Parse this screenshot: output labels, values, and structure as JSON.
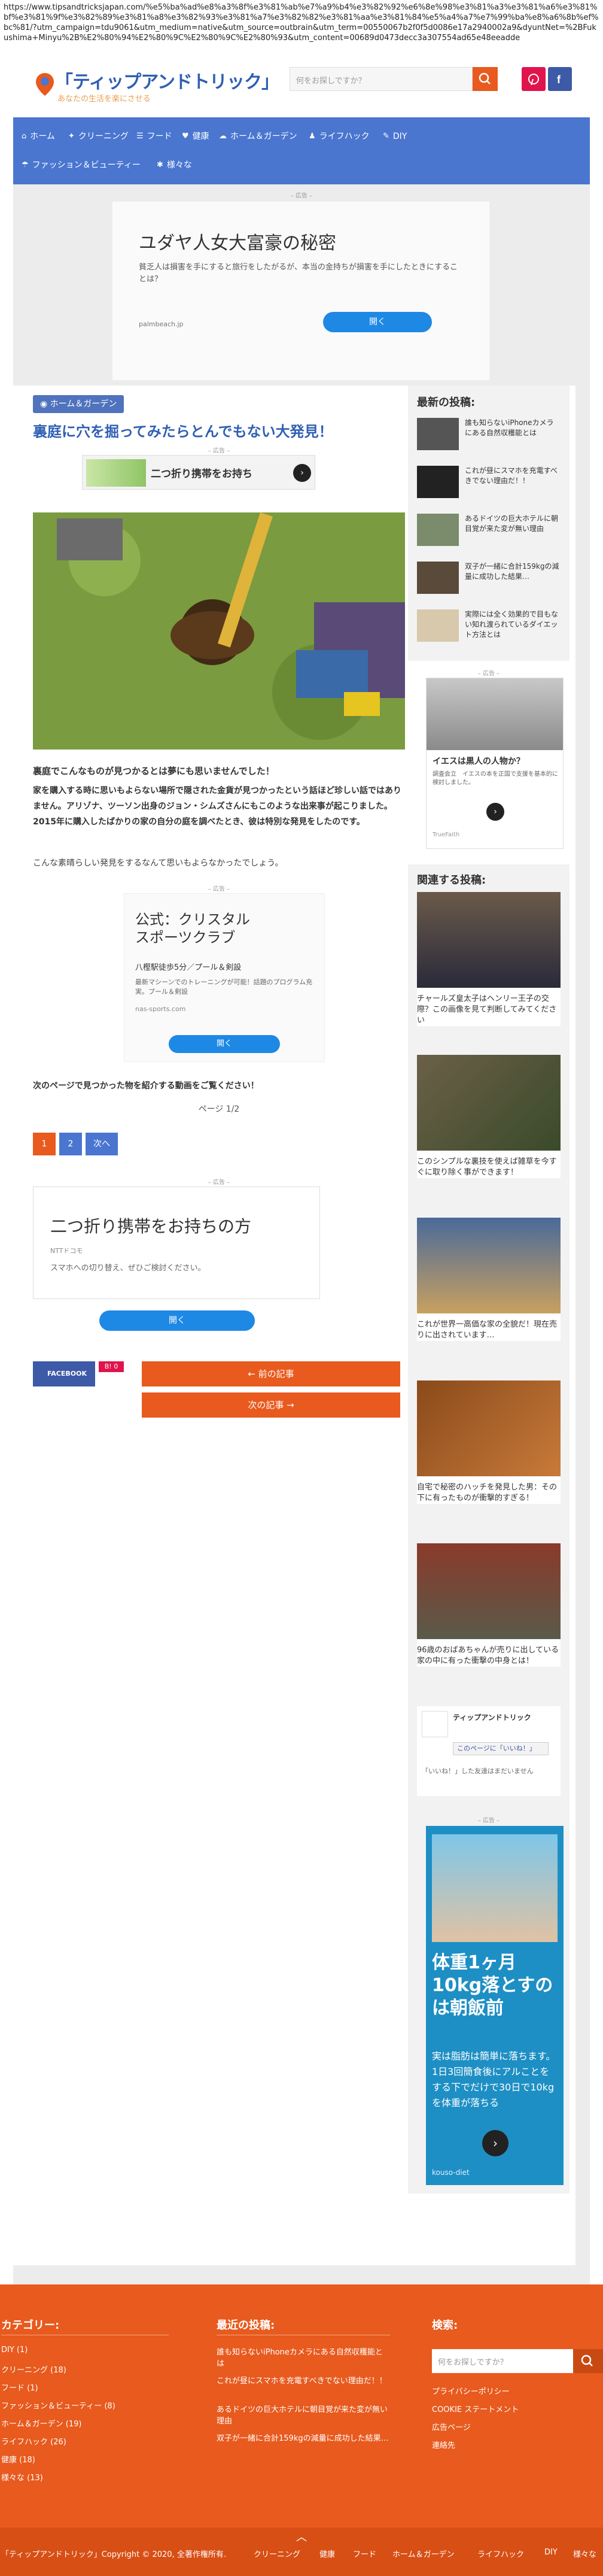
{
  "browser": {
    "url": "https://www.tipsandtricksjapan.com/%e5%ba%ad%e8%a3%8f%e3%81%ab%e7%a9%b4%e3%82%92%e6%8e%98%e3%81%a3%e3%81%a6%e3%81%bf%e3%81%9f%e3%82%89%e3%81%a8%e3%82%93%e3%81%a7%e3%82%82%e3%81%aa%e3%81%84%e5%a4%a7%e7%99%ba%e8%a6%8b%ef%bc%81/?utm_campaign=tdu9061&utm_medium=native&utm_source=outbrain&utm_term=00550067b2f0f5d0086e17a2940002a9&dyuntNet=%2BFukushima+Minyu%2B%E2%80%94%E2%80%9C%E2%80%9C%E2%80%93&utm_content=00689d0473decc3a307554ad65e48eeadde"
  },
  "header": {
    "logo_title": "「ティップアンドトリック」",
    "logo_subtitle": "あなたの生活を楽にさせる",
    "search_placeholder": "何をお探しですか？",
    "search_icon": "search-icon",
    "social": [
      "pinterest-icon",
      "facebook-icon"
    ]
  },
  "nav": {
    "items": [
      {
        "icon": "home-icon",
        "label": "ホーム"
      },
      {
        "icon": "cleaning-icon",
        "label": "クリーニング"
      },
      {
        "icon": "food-icon",
        "label": "フード"
      },
      {
        "icon": "health-icon",
        "label": "健康"
      },
      {
        "icon": "home-garden-icon",
        "label": "ホーム＆ガーデン"
      },
      {
        "icon": "lifehack-icon",
        "label": "ライフハック"
      },
      {
        "icon": "diy-icon",
        "label": "DIY"
      },
      {
        "icon": "fashion-icon",
        "label": "ファッション＆ビューティー"
      },
      {
        "icon": "misc-icon",
        "label": "様々な"
      }
    ]
  },
  "ads": {
    "label": "– 広告 –",
    "top": {
      "headline": "ユダヤ人女大富豪の秘密",
      "body": "貧乏人は損害を手にすると旅行をしたがるが、本当の金持ちが損害を手にしたときにすることは？",
      "domain": "palmbeach.jp",
      "button": "開く"
    },
    "inline1": {
      "text": "二つ折り携帯をお持ち"
    },
    "inline2": {
      "headline": "公式：クリスタル スポーツクラブ",
      "sub": "八樫駅徒歩5分／プール＆剣設",
      "body": "最新マシーンでのトレーニングが可能！話題のプログラム充実。プール＆剣設",
      "domain": "nas-sports.com",
      "button": "開く"
    },
    "inline3": {
      "headline": "二つ折り携帯をお持ちの方",
      "brand": "NTTドコモ",
      "body": "スマホへの切り替え、ぜひご検討ください。",
      "button": "開く"
    },
    "sidebar1": {
      "headline": "イエスは黒人の人物か？",
      "body": "調査会立　イエスの本を正国で支援を基本的に検討しました。",
      "brand": "TrueFaith"
    },
    "sidebar2": {
      "headline": "体重1ヶ月10kg落とすのは朝飯前",
      "body": "実は脂肪は簡単に落ちます。1日3回簡食後にアルことをする下でだけで30日で10kgを体重が落ちる",
      "domain": "kouso-diet"
    }
  },
  "article": {
    "category_icon": "tag-icon",
    "category": "ホーム＆ガーデン",
    "title": "裏庭に穴を掘ってみたらとんでもない大発見！",
    "hero_image": "digging-in-backyard-photo",
    "lead": "裏庭でこんなものが見つかるとは夢にも思いませんでした！",
    "para1": "家を購入する時に思いもよらない場所で隠された金貨が見つかったという話ほど珍しい話ではありません。アリゾナ、ツーソン出身のジョン・シムズさんにもこのような出来事が起こりました。2015年に購入したばかりの家の自分の庭を調べたとき、彼は特別な発見をしたのです。",
    "para2": "こんな素晴らしい発見をするなんて思いもよらなかったでしょう。",
    "next_page": "次のページで見つかった物を紹介する動画をご覧ください！",
    "page_counter": "ページ 1/2",
    "pages": [
      "1",
      "2",
      "次へ"
    ],
    "share": {
      "facebook": "FACEBOOK",
      "hatena": "B! 0"
    },
    "prev_post": "← 前の記事",
    "next_post": "次の記事 →"
  },
  "sidebar": {
    "recent_title": "最新の投稿:",
    "recent": [
      "誰も知らないiPhoneカメラにある自然収穫能とは",
      "これが昼にスマホを充電すべきでない理由だ！！",
      "あるドイツの巨大ホテルに朝目覚が来た変が無い理由",
      "双子が一緒に合計159kgの減量に成功した結果…",
      "実際には全く効果的で目もない知れ渡られているダイエット方法とは"
    ],
    "related_title": "関連する投稿:",
    "related": [
      "チャールズ皇太子はヘンリー王子の交際？この画像を見て判断してみてください",
      "このシンプルな裏技を使えば雑草を今すぐに取り除く事ができます！",
      "これが世界一高価な家の全貌だ！現在売りに出されています…",
      "自宅で秘密のハッチを発見した男：その下に有ったものが衝撃的すぎる！",
      "96歳のおばあちゃんが売りに出している家の中に有った衝撃の中身とは！",
      "ティップアンドトリック\nこのページに「いいね！」"
    ],
    "fb_widget": {
      "title": "ティップアンドトリック",
      "like": "このページに「いいね！」",
      "note": "「いいね！」した友達はまだいません"
    }
  },
  "footer": {
    "categories_title": "カテゴリー:",
    "categories": [
      "DIY (1)",
      "クリーニング (18)",
      "フード (1)",
      "ファッション＆ビューティー (8)",
      "ホーム＆ガーデン (19)",
      "ライフハック (26)",
      "健康 (18)",
      "様々な (13)"
    ],
    "recent_title": "最近の投稿:",
    "recent": [
      "誰も知らないiPhoneカメラにある自然収穫能とは",
      "これが昼にスマホを充電すべきでない理由だ！！",
      "あるドイツの巨大ホテルに朝目覚が来た変が無い理由",
      "双子が一緒に合計159kgの減量に成功した結果…"
    ],
    "search_title": "検索:",
    "search_placeholder": "何をお探しですか？",
    "links": [
      "プライバシーポリシー",
      "COOKIE ステートメント",
      "広告ページ",
      "連絡先"
    ],
    "copyright": "「ティップアンドトリック」Copyright © 2020, 全著作権所有.",
    "bottom_nav": [
      "クリーニング",
      "健康",
      "フード",
      "ホーム＆ガーデン",
      "ライフハック",
      "DIY",
      "様々な"
    ],
    "back_to_top_icon": "chevron-up-icon"
  },
  "colors": {
    "brand_blue": "#4a76d0",
    "accent_orange": "#e85a1e",
    "title_blue": "#2f5fb3",
    "facebook": "#3d5aa7",
    "pinterest": "#e0144d"
  }
}
